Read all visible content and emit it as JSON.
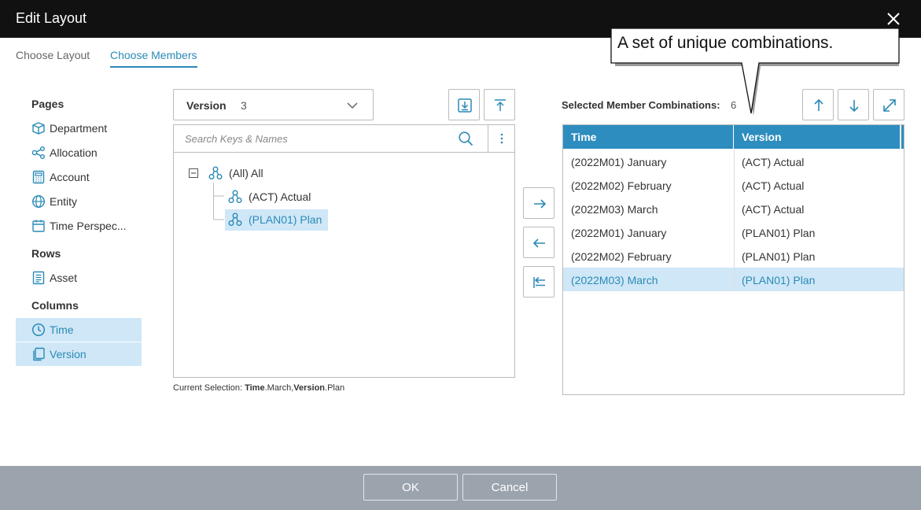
{
  "window": {
    "title": "Edit Layout",
    "close_icon": "close-icon"
  },
  "tabs": [
    {
      "label": "Choose Layout",
      "active": false
    },
    {
      "label": "Choose Members",
      "active": true
    }
  ],
  "sidebar": {
    "pages_label": "Pages",
    "pages": [
      {
        "label": "Department",
        "icon": "cube-icon"
      },
      {
        "label": "Allocation",
        "icon": "share-nodes-icon"
      },
      {
        "label": "Account",
        "icon": "calculator-icon"
      },
      {
        "label": "Entity",
        "icon": "globe-icon"
      },
      {
        "label": "Time Perspec...",
        "icon": "calendar-icon"
      }
    ],
    "rows_label": "Rows",
    "rows": [
      {
        "label": "Asset",
        "icon": "list-doc-icon"
      }
    ],
    "columns_label": "Columns",
    "columns": [
      {
        "label": "Time",
        "icon": "clock-icon",
        "selected": true
      },
      {
        "label": "Version",
        "icon": "copy-icon",
        "selected": true
      }
    ]
  },
  "dimension_select": {
    "name": "Version",
    "count": "3"
  },
  "search": {
    "placeholder": "Search Keys & Names",
    "value": ""
  },
  "tree": [
    {
      "label": "(All) All",
      "level": 0,
      "expanded": true,
      "selected": false
    },
    {
      "label": "(ACT) Actual",
      "level": 1,
      "selected": false
    },
    {
      "label": "(PLAN01) Plan",
      "level": 1,
      "selected": true
    }
  ],
  "current_selection": {
    "prefix": "Current Selection: ",
    "dim1": "Time",
    "val1": ".March,",
    "dim2": "Version",
    "val2": ".Plan"
  },
  "selected_combinations": {
    "label": "Selected Member Combinations:",
    "count": "6",
    "columns": [
      "Time",
      "Version"
    ],
    "rows": [
      {
        "time": "(2022M01) January",
        "version": "(ACT) Actual",
        "selected": false
      },
      {
        "time": "(2022M02) February",
        "version": "(ACT) Actual",
        "selected": false
      },
      {
        "time": "(2022M03) March",
        "version": "(ACT) Actual",
        "selected": false
      },
      {
        "time": "(2022M01) January",
        "version": "(PLAN01) Plan",
        "selected": false
      },
      {
        "time": "(2022M02) February",
        "version": "(PLAN01) Plan",
        "selected": false
      },
      {
        "time": "(2022M03) March",
        "version": "(PLAN01) Plan",
        "selected": true
      }
    ]
  },
  "callout": {
    "text": "A set of unique combinations."
  },
  "footer": {
    "ok_label": "OK",
    "cancel_label": "Cancel"
  },
  "colors": {
    "accent": "#2b8ab6",
    "header_bg": "#2d8dbf",
    "selection_bg": "#cfe7f7",
    "title_bg": "#111111",
    "footer_bg": "#9ba3ad"
  }
}
